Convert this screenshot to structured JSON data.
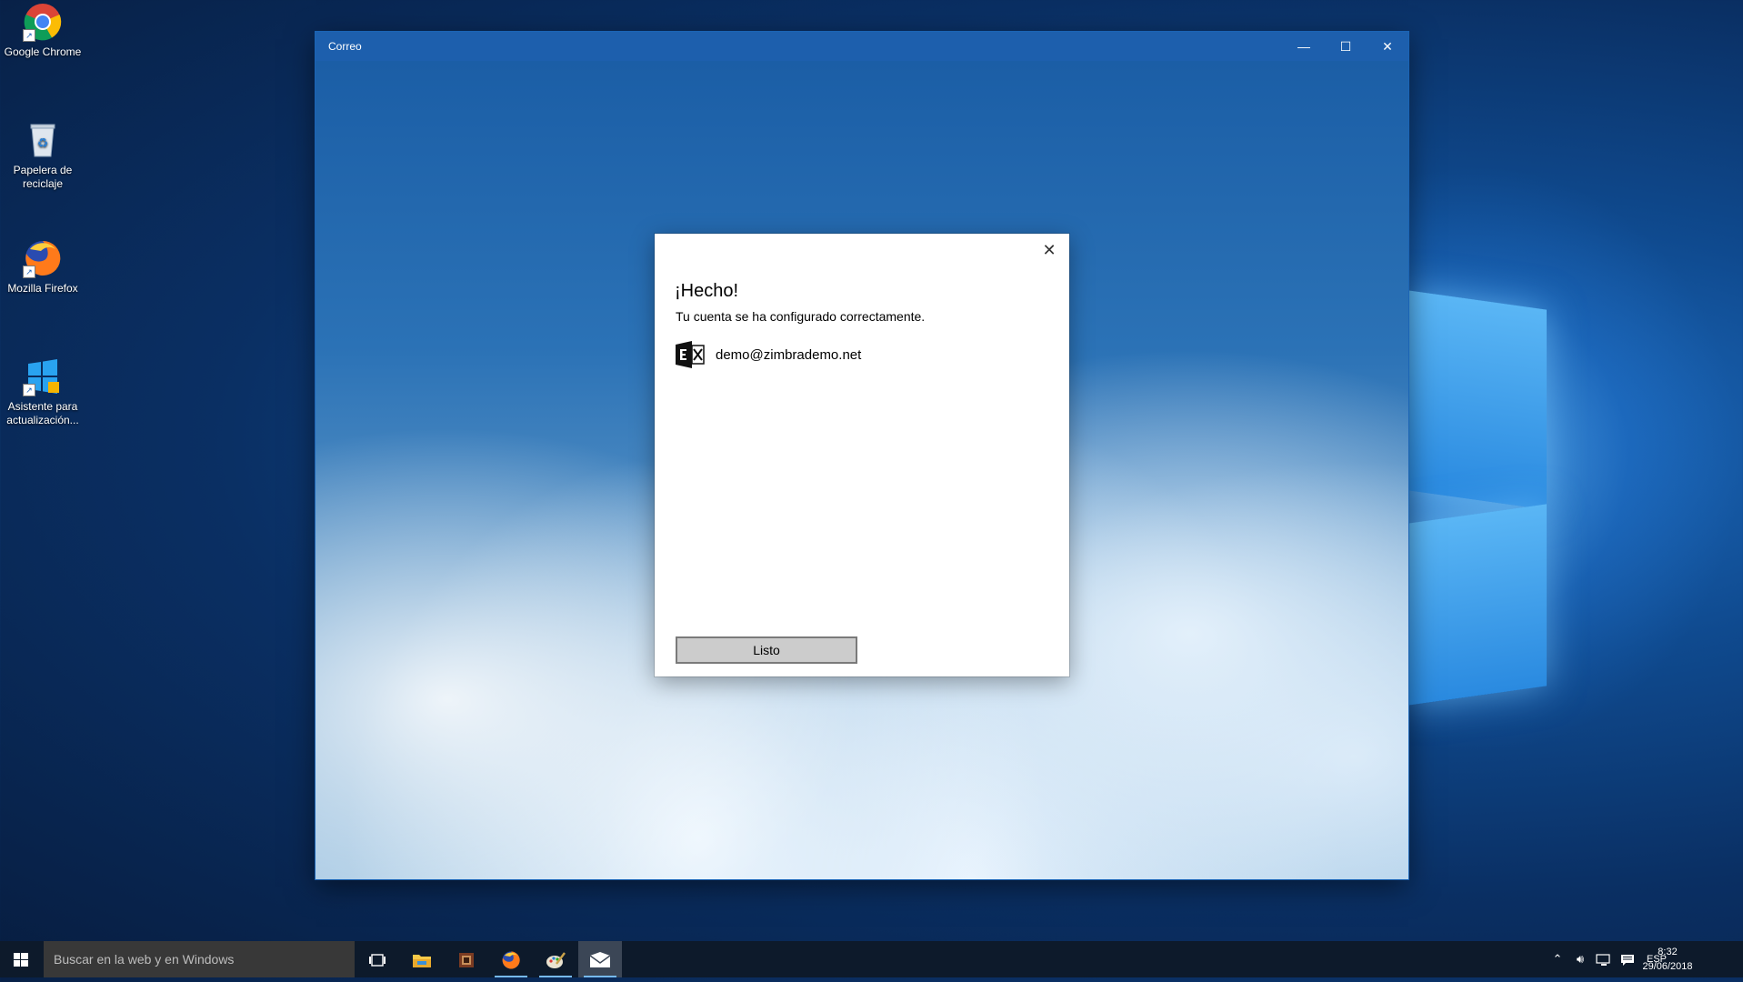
{
  "desktop": {
    "icons": [
      {
        "label": "Google Chrome",
        "icon": "chrome-icon"
      },
      {
        "label": "Papelera de reciclaje",
        "icon": "recycle-bin-icon"
      },
      {
        "label": "Mozilla Firefox",
        "icon": "firefox-icon"
      },
      {
        "label": "Asistente para actualización...",
        "icon": "windows-update-assistant-icon"
      }
    ]
  },
  "window": {
    "title": "Correo",
    "controls": {
      "minimize": "—",
      "maximize": "☐",
      "close": "✕"
    }
  },
  "dialog": {
    "heading": "¡Hecho!",
    "subtitle": "Tu cuenta se ha configurado correctamente.",
    "account_email": "demo@zimbrademo.net",
    "account_icon": "exchange-icon",
    "close_glyph": "✕",
    "done_button": "Listo"
  },
  "taskbar": {
    "search_placeholder": "Buscar en la web y en Windows",
    "apps": [
      "task-view-icon",
      "file-explorer-icon",
      "app-icon",
      "firefox-icon",
      "paint-icon",
      "mail-icon"
    ],
    "language": "ESP",
    "time": "8:32",
    "date": "29/06/2018"
  },
  "colors": {
    "titlebar": "#1d5fad",
    "taskbar": "#0d1a2b",
    "search_box": "#383838",
    "button": "#cccccc"
  }
}
